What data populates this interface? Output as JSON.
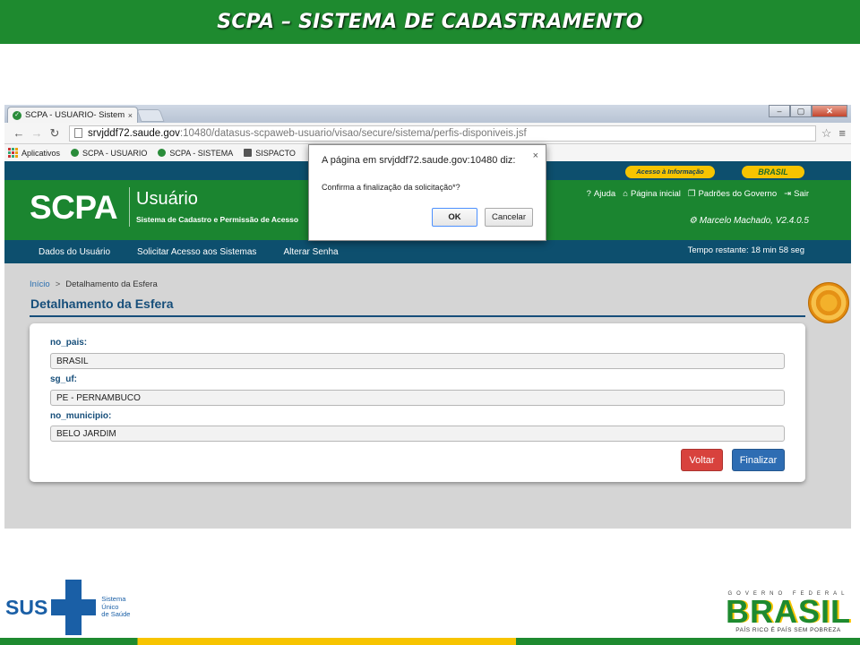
{
  "slide": {
    "title": "SCPA – SISTEMA DE CADASTRAMENTO"
  },
  "browser": {
    "tab_label": "SCPA - USUARIO- Sistema",
    "tab_close": "×",
    "url_host": "srvjddf72.saude.gov",
    "url_path": ":10480/datasus-scpaweb-usuario/visao/secure/sistema/perfis-disponiveis.jsf",
    "bookmarks": [
      "Aplicativos",
      "SCPA - USUARIO",
      "SCPA - SISTEMA",
      "SISPACTO"
    ]
  },
  "gov_bar": {
    "access_label": "Acesso à Informação",
    "brasil_label": "BRASIL"
  },
  "header": {
    "logo": "SCPA",
    "subtitle": "Usuário",
    "description": "Sistema de Cadastro e Permissão de Acesso",
    "links": [
      "Ajuda",
      "Página inicial",
      "Padrões do Governo",
      "Sair"
    ],
    "user": "Marcelo Machado, V2.4.0.5"
  },
  "navbar": {
    "items": [
      "Dados do Usuário",
      "Solicitar Acesso aos Sistemas",
      "Alterar Senha"
    ],
    "timer": "Tempo restante: 18 min 58 seg"
  },
  "page": {
    "breadcrumb_home": "Início",
    "breadcrumb_sep": ">",
    "breadcrumb_current": "Detalhamento da Esfera",
    "title": "Detalhamento da Esfera",
    "fields": [
      {
        "label": "no_pais:",
        "value": "BRASIL"
      },
      {
        "label": "sg_uf:",
        "value": "PE - PERNAMBUCO"
      },
      {
        "label": "no_municipio:",
        "value": "BELO JARDIM"
      }
    ],
    "btn_back": "Voltar",
    "btn_finish": "Finalizar"
  },
  "dialog": {
    "title": "A página em srvjddf72.saude.gov:10480 diz:",
    "message": "Confirma a finalização da solicitação*?",
    "ok": "OK",
    "cancel": "Cancelar",
    "close": "×"
  },
  "footer": {
    "sus_text": "SUS",
    "sus_sub": [
      "Sistema",
      "Único",
      "de Saúde"
    ],
    "gov_small": "GOVERNO FEDERAL",
    "gov_big": "BRASIL",
    "gov_tag": "PAÍS RICO É PAÍS SEM POBREZA"
  },
  "colors": {
    "green": "#1b8530",
    "navy": "#0d4f6e",
    "yellow": "#f7c400",
    "title_blue": "#164e7a"
  }
}
